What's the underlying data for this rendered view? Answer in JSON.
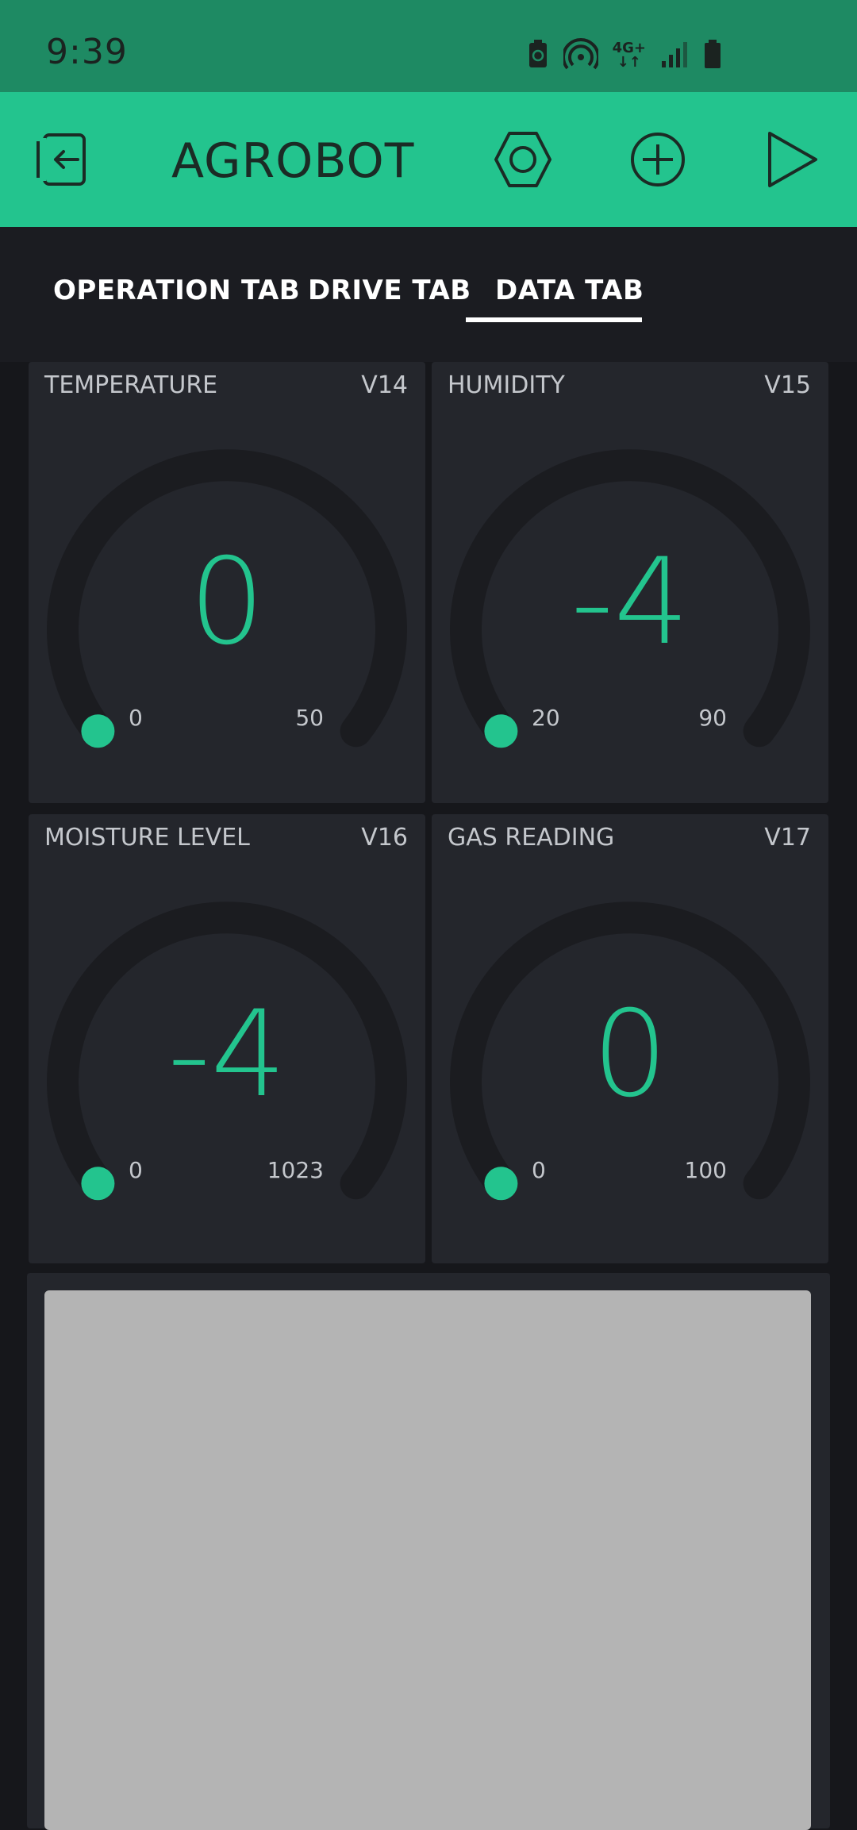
{
  "status_bar": {
    "time": "9:39",
    "icons": [
      "battery-saver-icon",
      "hotspot-icon",
      "network-4g-icon",
      "signal-icon",
      "battery-icon"
    ],
    "network_label": "4G+"
  },
  "app_bar": {
    "title": "AGROBOT",
    "icons": [
      "exit-icon",
      "settings-hexagon-icon",
      "add-icon",
      "play-icon"
    ]
  },
  "tabs": [
    {
      "label": "OPERATION TAB",
      "active": false
    },
    {
      "label": "DRIVE TAB",
      "active": false
    },
    {
      "label": "DATA TAB",
      "active": true
    }
  ],
  "gauges": [
    {
      "label": "TEMPERATURE",
      "pin": "V14",
      "value": "0",
      "min": "0",
      "max": "50",
      "level": 0
    },
    {
      "label": "HUMIDITY",
      "pin": "V15",
      "value": "-4",
      "min": "20",
      "max": "90",
      "level": 0
    },
    {
      "label": "MOISTURE LEVEL",
      "pin": "V16",
      "value": "-4",
      "min": "0",
      "max": "1023",
      "level": 0
    },
    {
      "label": "GAS READING",
      "pin": "V17",
      "value": "0",
      "min": "0",
      "max": "100",
      "level": 0
    }
  ],
  "colors": {
    "accent": "#23c48e",
    "status_bar": "#1e8a63",
    "card": "#24262c",
    "background": "#16171b",
    "track": "#1b1c20"
  }
}
